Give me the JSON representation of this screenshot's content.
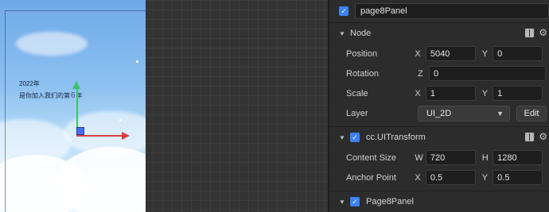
{
  "scene": {
    "preview_year": "2022年",
    "preview_line_prefix": "是你加入我们的第",
    "preview_number": "6",
    "preview_line_suffix": "年"
  },
  "inspector": {
    "node_name": "page8Panel",
    "node_section": {
      "title": "Node",
      "position": {
        "label": "Position",
        "x_axis": "X",
        "x": "5040",
        "y_axis": "Y",
        "y": "0"
      },
      "rotation": {
        "label": "Rotation",
        "z_axis": "Z",
        "z": "0"
      },
      "scale": {
        "label": "Scale",
        "x_axis": "X",
        "x": "1",
        "y_axis": "Y",
        "y": "1"
      },
      "layer": {
        "label": "Layer",
        "value": "UI_2D",
        "edit_label": "Edit"
      }
    },
    "transform_section": {
      "title": "cc.UITransform",
      "content_size": {
        "label": "Content Size",
        "w_axis": "W",
        "w": "720",
        "h_axis": "H",
        "h": "1280"
      },
      "anchor_point": {
        "label": "Anchor Point",
        "x_axis": "X",
        "x": "0.5",
        "y_axis": "Y",
        "y": "0.5"
      }
    },
    "script_section": {
      "title": "Page8Panel"
    }
  },
  "icons": [
    "checkbox-checked-icon",
    "caret-down-icon",
    "book-icon",
    "gear-icon",
    "dropdown-arrow-icon"
  ],
  "colors": {
    "accent": "#3b82f6",
    "gizmo_x": "#d94040",
    "gizmo_y": "#3cc36a",
    "gizmo_center": "#4a6cf0"
  }
}
